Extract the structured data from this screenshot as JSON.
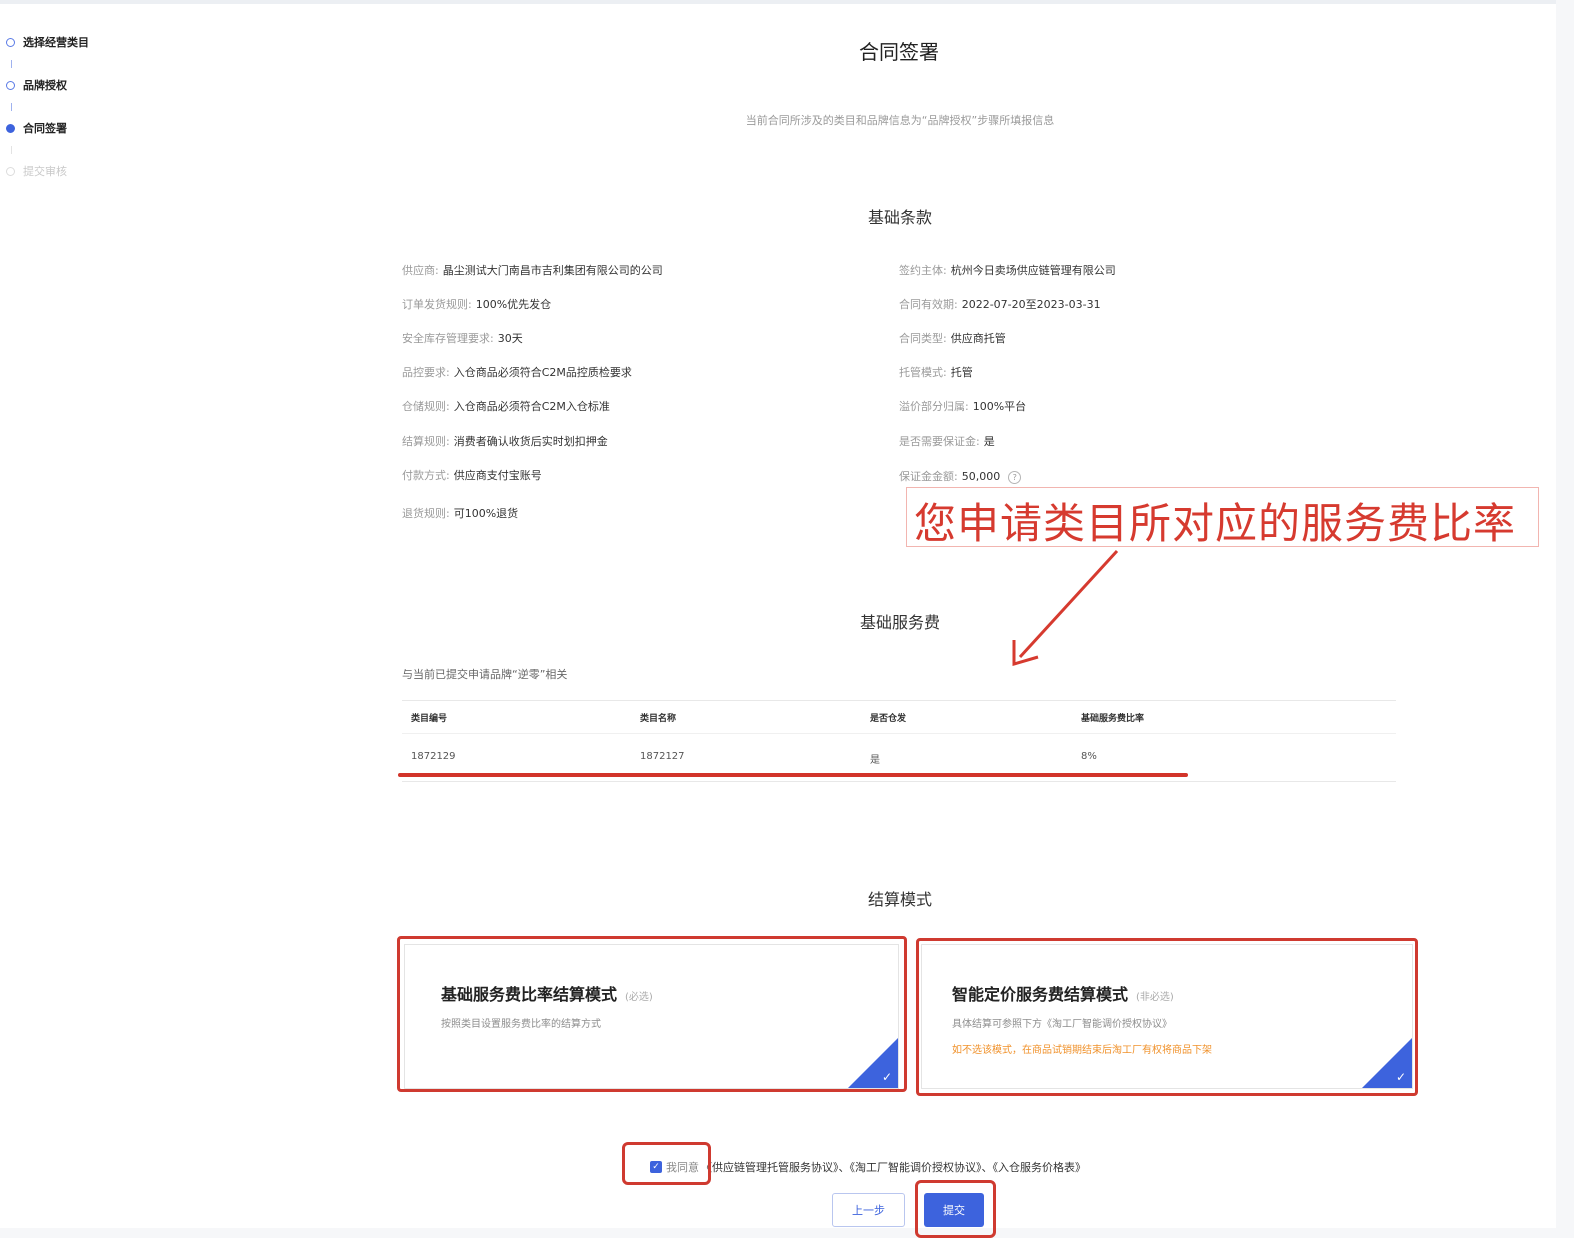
{
  "colors": {
    "accent": "#3d63dd",
    "annotation": "#d63a2f",
    "warning": "#f0922c"
  },
  "steps": [
    {
      "label": "选择经营类目",
      "state": "done"
    },
    {
      "label": "品牌授权",
      "state": "done"
    },
    {
      "label": "合同签署",
      "state": "active"
    },
    {
      "label": "提交审核",
      "state": "pending"
    }
  ],
  "page": {
    "title": "合同签署",
    "subtitle": "当前合同所涉及的类目和品牌信息为“品牌授权”步骤所填报信息"
  },
  "basic_terms": {
    "title": "基础条款",
    "left": [
      {
        "key": "供应商:",
        "value": "晶尘测试大门南昌市吉利集团有限公司的公司"
      },
      {
        "key": "订单发货规则:",
        "value": "100%优先发仓"
      },
      {
        "key": "安全库存管理要求:",
        "value": "30天"
      },
      {
        "key": "品控要求:",
        "value": "入仓商品必须符合C2M品控质检要求"
      },
      {
        "key": "仓储规则:",
        "value": "入仓商品必须符合C2M入仓标准"
      },
      {
        "key": "结算规则:",
        "value": "消费者确认收货后实时划扣押金"
      },
      {
        "key": "付款方式:",
        "value": "供应商支付宝账号"
      },
      {
        "key": "退货规则:",
        "value": "可100%退货"
      }
    ],
    "right": [
      {
        "key": "签约主体:",
        "value": "杭州今日卖场供应链管理有限公司"
      },
      {
        "key": "合同有效期:",
        "value": "2022-07-20至2023-03-31"
      },
      {
        "key": "合同类型:",
        "value": "供应商托管"
      },
      {
        "key": "托管模式:",
        "value": "托管"
      },
      {
        "key": "溢价部分归属:",
        "value": "100%平台"
      },
      {
        "key": "是否需要保证金:",
        "value": "是"
      },
      {
        "key": "保证金金额:",
        "value": "50,000"
      }
    ],
    "help_icon": "?"
  },
  "annotation": {
    "text": "您申请类目所对应的服务费比率"
  },
  "service_fee": {
    "title": "基础服务费",
    "related": "与当前已提交申请品牌“逆零”相关",
    "columns": [
      "类目编号",
      "类目名称",
      "是否仓发",
      "基础服务费比率"
    ],
    "rows": [
      [
        "1872129",
        "1872127",
        "是",
        "8%"
      ]
    ]
  },
  "settlement": {
    "title": "结算模式",
    "cards": [
      {
        "title": "基础服务费比率结算模式",
        "tag": "(必选)",
        "desc": "按照类目设置服务费比率的结算方式",
        "warn": ""
      },
      {
        "title": "智能定价服务费结算模式",
        "tag": "(非必选)",
        "desc": "具体结算可参照下方《淘工厂智能调价授权协议》",
        "warn": "如不选该模式，在商品试销期结束后淘工厂有权将商品下架"
      }
    ],
    "check": "✓"
  },
  "agreement": {
    "checkbox": "✓",
    "label": "我同意",
    "docs": "《供应链管理托管服务协议》、《淘工厂智能调价授权协议》、《入仓服务价格表》"
  },
  "buttons": {
    "prev": "上一步",
    "submit": "提交"
  }
}
